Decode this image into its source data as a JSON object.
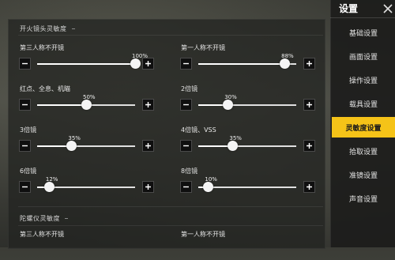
{
  "sidebar": {
    "title": "设置",
    "items": [
      {
        "label": "基础设置",
        "active": false
      },
      {
        "label": "画面设置",
        "active": false
      },
      {
        "label": "操作设置",
        "active": false
      },
      {
        "label": "载具设置",
        "active": false
      },
      {
        "label": "灵敏度设置",
        "active": true
      },
      {
        "label": "拾取设置",
        "active": false
      },
      {
        "label": "准镜设置",
        "active": false
      },
      {
        "label": "声音设置",
        "active": false
      }
    ]
  },
  "colors": {
    "accent": "#f5c318",
    "panel": "#222321",
    "button": "#0f0f0f"
  },
  "section_fire": {
    "title": "开火镜头灵敏度",
    "items": [
      {
        "label": "第三人称不开镜",
        "value": "100%",
        "level": 1.0
      },
      {
        "label": "第一人称不开镜",
        "value": "88%",
        "level": 0.88
      },
      {
        "label": "红点、全息、机瞄",
        "value": "50%",
        "level": 0.5
      },
      {
        "label": "2倍镜",
        "value": "30%",
        "level": 0.3
      },
      {
        "label": "3倍镜",
        "value": "35%",
        "level": 0.35
      },
      {
        "label": "4倍镜、VSS",
        "value": "35%",
        "level": 0.35
      },
      {
        "label": "6倍镜",
        "value": "12%",
        "level": 0.12
      },
      {
        "label": "8倍镜",
        "value": "10%",
        "level": 0.1
      }
    ]
  },
  "section_gyro": {
    "title": "陀螺仪灵敏度",
    "items": [
      {
        "label": "第三人称不开镜"
      },
      {
        "label": "第一人称不开镜"
      }
    ]
  }
}
